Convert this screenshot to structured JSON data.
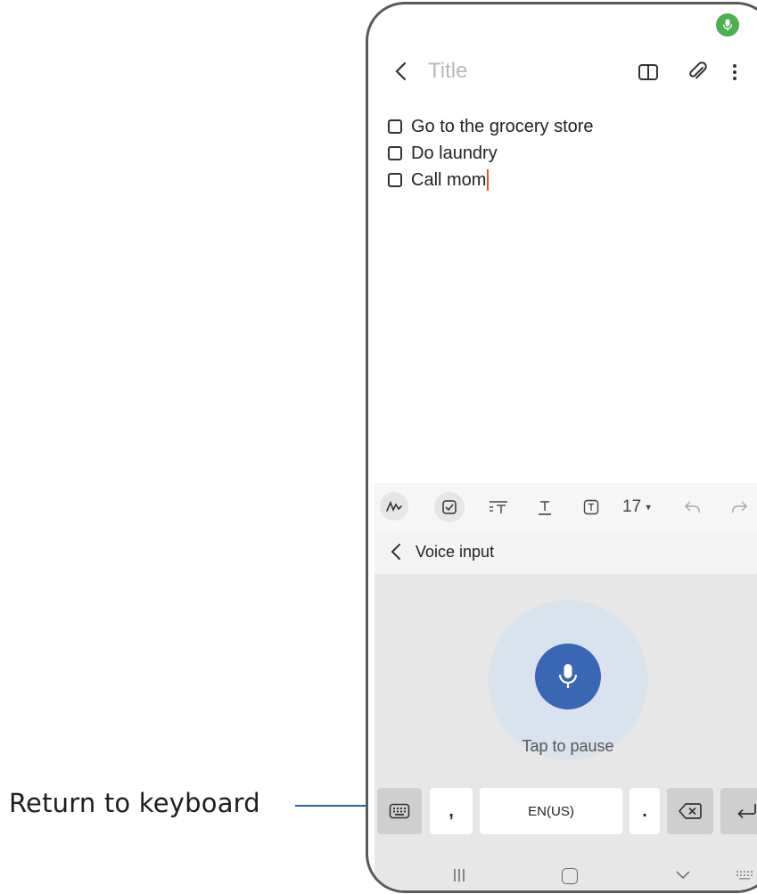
{
  "callout": {
    "label": "Return to keyboard"
  },
  "note": {
    "title_placeholder": "Title",
    "checklist": [
      {
        "text": "Go to the grocery store",
        "checked": false
      },
      {
        "text": "Do laundry",
        "checked": false
      },
      {
        "text": "Call mom",
        "checked": false
      }
    ]
  },
  "toolbar": {
    "font_size": "17",
    "icons": [
      "handwriting-icon",
      "checkbox-icon",
      "paragraph-style-icon",
      "text-style-icon",
      "text-box-icon",
      "undo-icon",
      "redo-icon"
    ]
  },
  "voice": {
    "header_label": "Voice input",
    "status": "Tap to pause"
  },
  "keyboard": {
    "comma": ",",
    "space_label": "EN(US)",
    "period": "."
  },
  "colors": {
    "mic_button": "#3a67b4",
    "mic_ripple": "#d9e3ed",
    "recording_indicator": "#4caf50",
    "cursor": "#e0572e",
    "callout_line": "#2b63a6"
  }
}
